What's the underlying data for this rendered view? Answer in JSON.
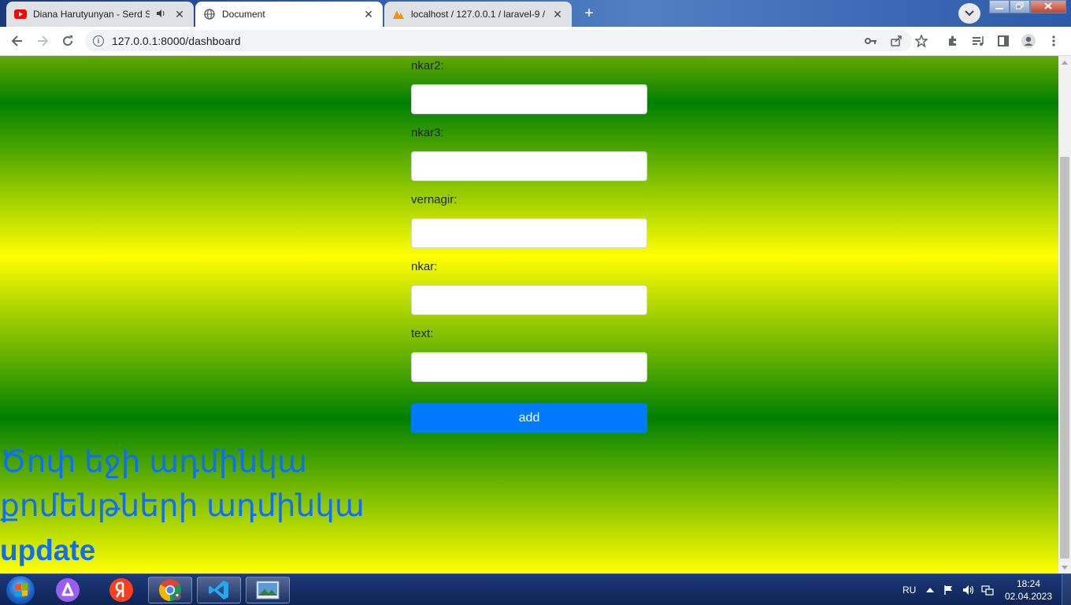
{
  "browser": {
    "tabs": [
      {
        "title": "Diana Harutyunyan - Serd Sa",
        "favicon": "youtube-icon",
        "active": false,
        "audio": true
      },
      {
        "title": "Document",
        "favicon": "globe-icon",
        "active": true,
        "audio": false
      },
      {
        "title": "localhost / 127.0.0.1 / laravel-9 / ",
        "favicon": "phpmyadmin-icon",
        "active": false,
        "audio": false
      }
    ],
    "close_glyph": "✕",
    "new_tab_glyph": "+",
    "url": "127.0.0.1:8000/dashboard"
  },
  "form": {
    "fields": [
      {
        "label": "nkar2:",
        "value": ""
      },
      {
        "label": "nkar3:",
        "value": ""
      },
      {
        "label": "vernagir:",
        "value": ""
      },
      {
        "label": "nkar:",
        "value": ""
      },
      {
        "label": "text:",
        "value": ""
      }
    ],
    "submit_label": "add"
  },
  "links": [
    "Ծոփ եջի ադմինկա",
    "քոմենթների ադմինկա",
    "update"
  ],
  "colors": {
    "link": "#0d6efd",
    "button": "#007bff",
    "gradient_green": "#008000",
    "gradient_yellow": "#ffff00"
  },
  "taskbar": {
    "language": "RU",
    "time": "18:24",
    "date": "02.04.2023",
    "apps": [
      "alice-icon",
      "yandex-icon",
      "chrome-icon",
      "vscode-icon",
      "photo-viewer-icon"
    ]
  }
}
